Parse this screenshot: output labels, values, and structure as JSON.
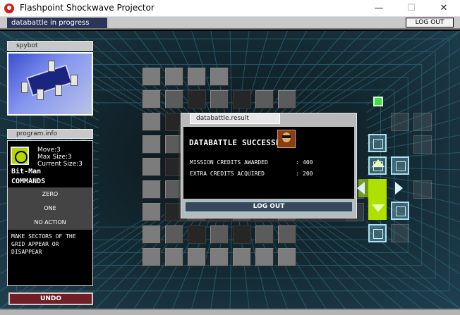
{
  "window": {
    "title": "Flashpoint Shockwave Projector",
    "minimize": "—",
    "maximize": "☐",
    "close": "✕",
    "app_icon": "flashpoint-icon"
  },
  "topbar": {
    "status": "databattle in progress",
    "logout": "LOG OUT"
  },
  "spybot": {
    "tab": "spybot"
  },
  "program": {
    "tab": "program.info",
    "move": "Move:3",
    "max_size": "Max Size:3",
    "current_size": "Current Size:3",
    "name": "Bit-Man",
    "commands_label": "COMMANDS",
    "commands": [
      "ZERO",
      "ONE",
      "NO ACTION"
    ],
    "description": "MAKE SECTORS OF THE GRID APPEAR OR DISAPPEAR",
    "icon": "bitman-icon"
  },
  "undo": "UNDO",
  "dialog": {
    "tab": "databattle.result",
    "headline": "DATABATTLE SUCCESSFUL",
    "rows": [
      {
        "label": "MISSION CREDITS AWARDED",
        "value": "400"
      },
      {
        "label": "EXTRA CREDITS ACQUIRED",
        "value": "200"
      }
    ],
    "logout": "LOG OUT"
  },
  "colors": {
    "accent_lime": "#aee000",
    "panel_blue": "#2a3558",
    "undo_red": "#6f1f26"
  }
}
